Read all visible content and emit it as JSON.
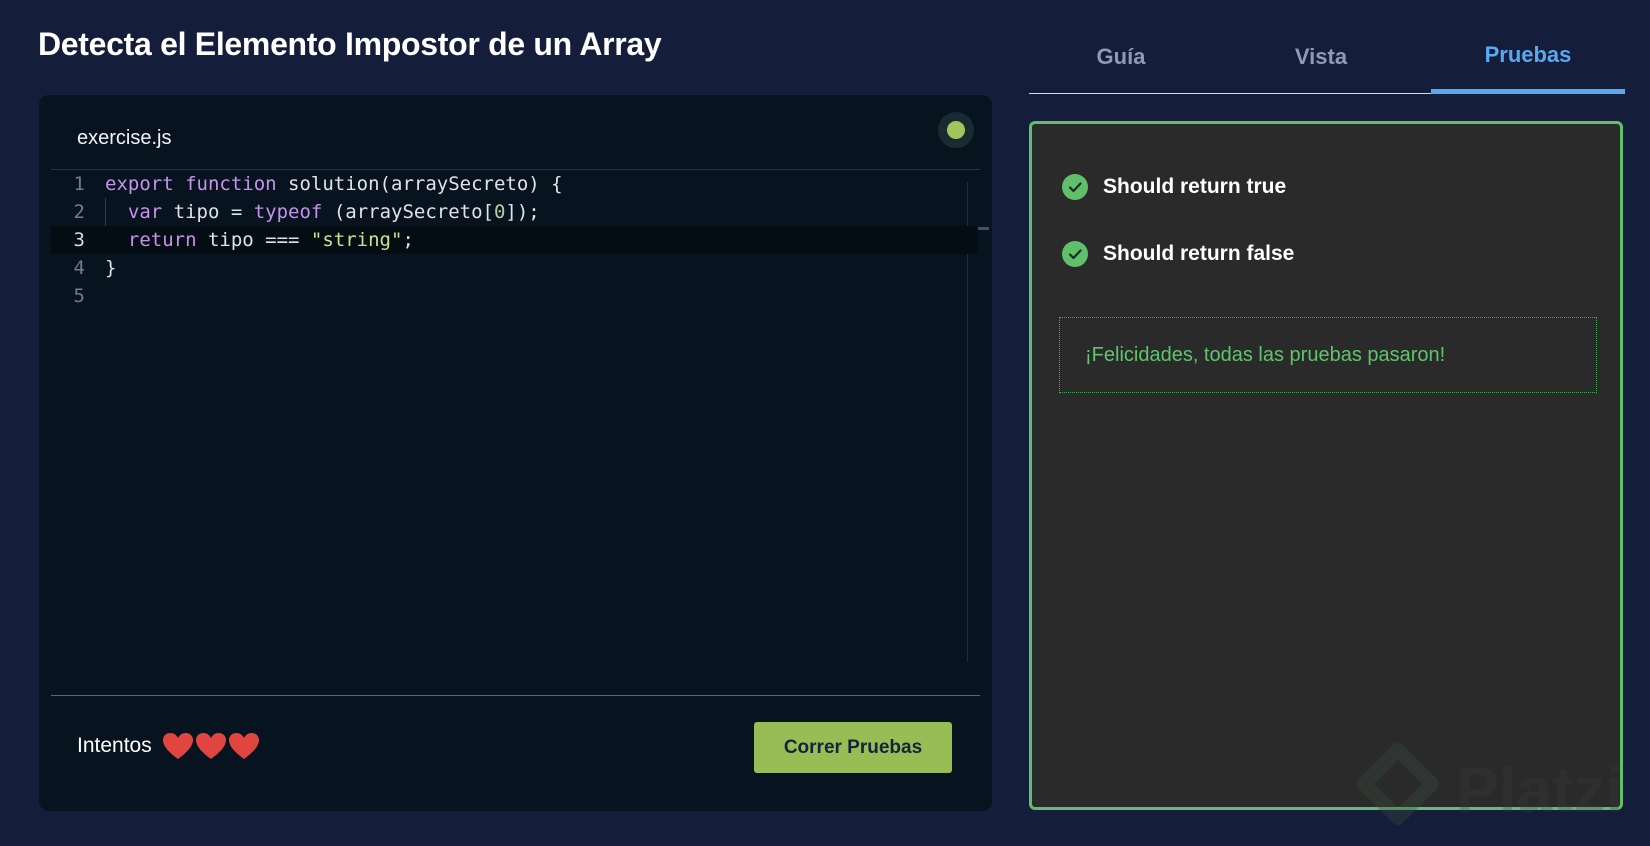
{
  "page": {
    "title": "Detecta el Elemento Impostor de un Array"
  },
  "editor": {
    "file_name": "exercise.js",
    "status_color": "#a2c55b",
    "active_line": 3,
    "lines": [
      {
        "number": "1",
        "tokens": [
          {
            "t": "export",
            "c": "kw"
          },
          {
            "t": " "
          },
          {
            "t": "function",
            "c": "kw"
          },
          {
            "t": " solution(arraySecreto) {"
          }
        ]
      },
      {
        "number": "2",
        "indent": "  ",
        "tokens": [
          {
            "t": "var",
            "c": "kw"
          },
          {
            "t": " tipo = "
          },
          {
            "t": "typeof",
            "c": "kw"
          },
          {
            "t": " (arraySecreto["
          },
          {
            "t": "0",
            "c": "num"
          },
          {
            "t": "]);"
          }
        ]
      },
      {
        "number": "3",
        "indent": "  ",
        "tokens": [
          {
            "t": "return",
            "c": "kw"
          },
          {
            "t": " tipo === "
          },
          {
            "t": "\"string\"",
            "c": "str"
          },
          {
            "t": ";"
          }
        ]
      },
      {
        "number": "4",
        "tokens": [
          {
            "t": "}"
          }
        ]
      },
      {
        "number": "5",
        "tokens": []
      }
    ]
  },
  "footer": {
    "attempts_label": "Intentos",
    "hearts_remaining": 3,
    "heart_color": "#e0463f",
    "run_button_label": "Correr Pruebas"
  },
  "tabs": [
    {
      "label": "Guía",
      "active": false
    },
    {
      "label": "Vista",
      "active": false
    },
    {
      "label": "Pruebas",
      "active": true
    }
  ],
  "tests": {
    "items": [
      {
        "label": "Should return true",
        "status": "passed"
      },
      {
        "label": "Should return false",
        "status": "passed"
      }
    ],
    "success_message": "¡Felicidades, todas las pruebas pasaron!",
    "pass_color": "#5fbf6a"
  },
  "watermark": {
    "text": "Platzi"
  }
}
